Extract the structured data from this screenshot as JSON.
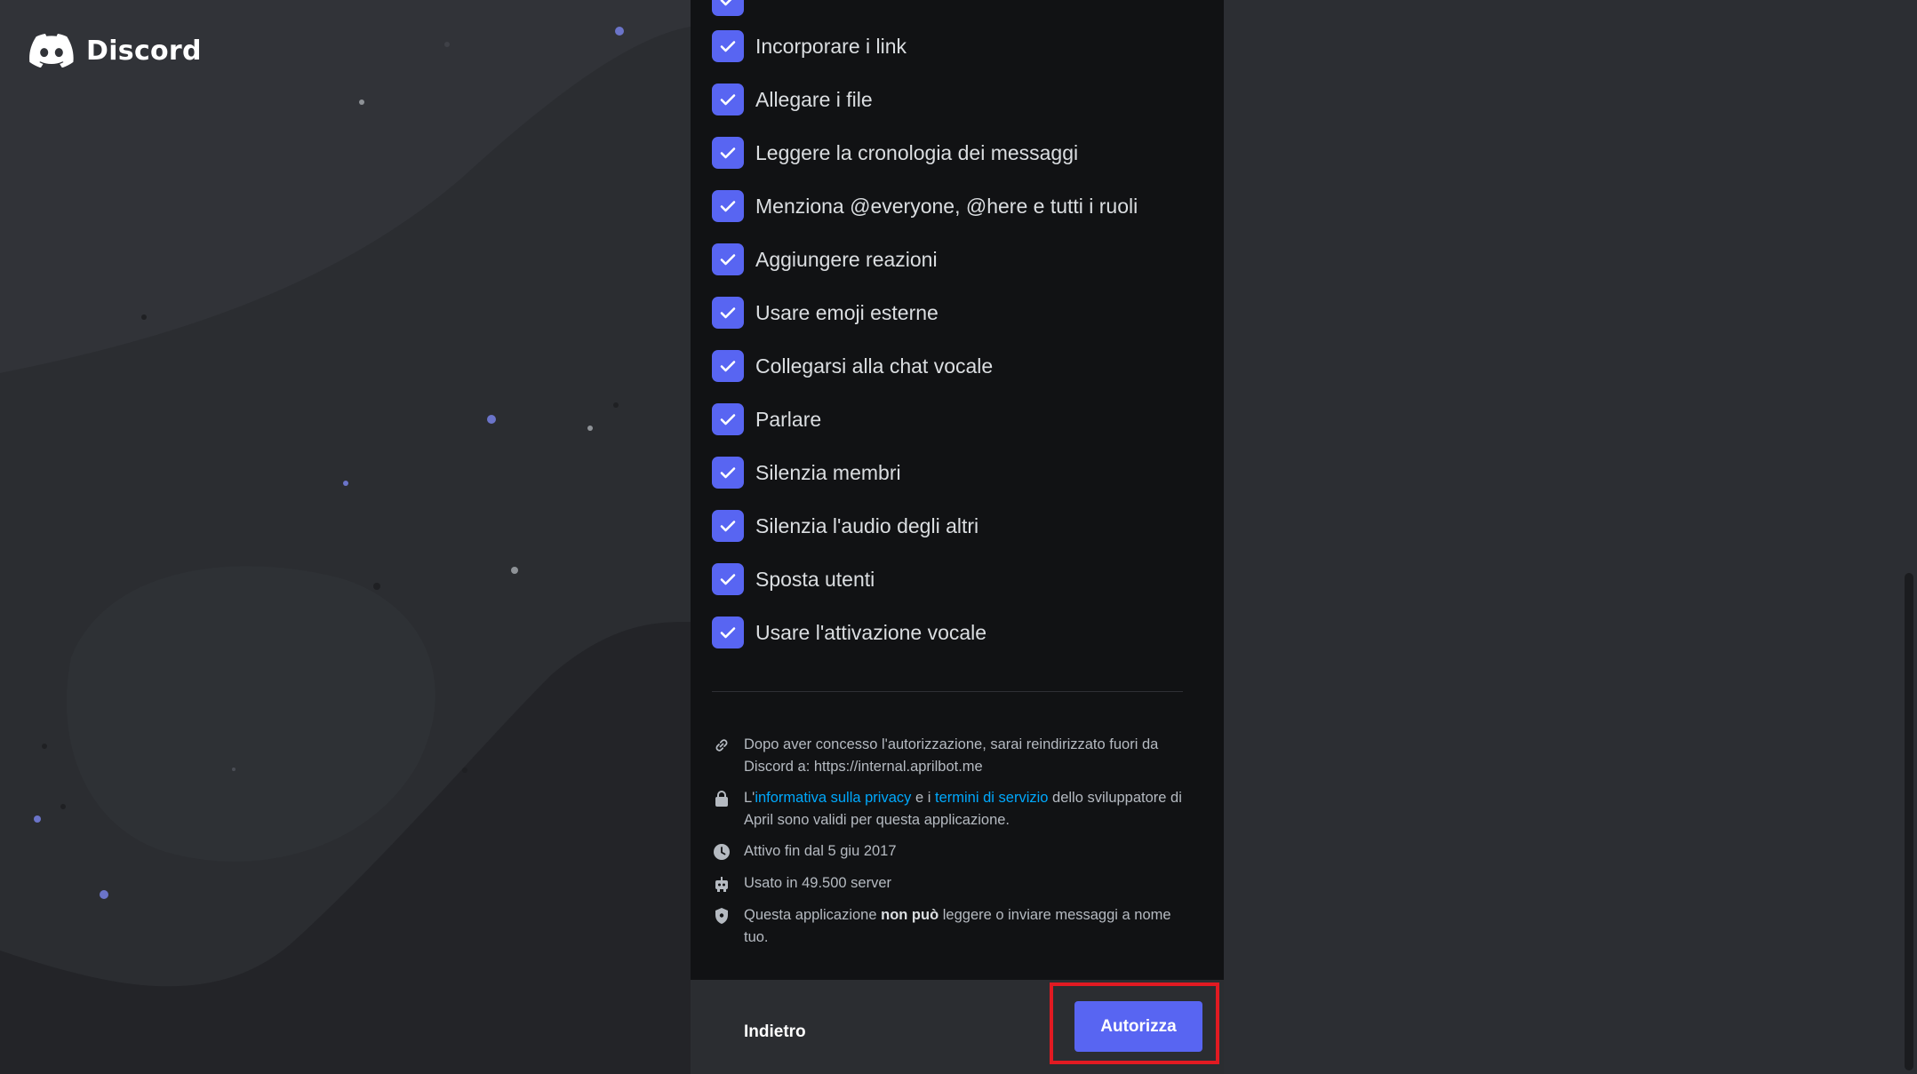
{
  "brand": {
    "name": "Discord",
    "icon": "discord-logo-icon"
  },
  "accent_color": "#5865f2",
  "permissions": [
    {
      "label": "Incorporare i link",
      "checked": true
    },
    {
      "label": "Allegare i file",
      "checked": true
    },
    {
      "label": "Leggere la cronologia dei messaggi",
      "checked": true
    },
    {
      "label": "Menziona @everyone, @here e tutti i ruoli",
      "checked": true
    },
    {
      "label": "Aggiungere reazioni",
      "checked": true
    },
    {
      "label": "Usare emoji esterne",
      "checked": true
    },
    {
      "label": "Collegarsi alla chat vocale",
      "checked": true
    },
    {
      "label": "Parlare",
      "checked": true
    },
    {
      "label": "Silenzia membri",
      "checked": true
    },
    {
      "label": "Silenzia l'audio degli altri",
      "checked": true
    },
    {
      "label": "Sposta utenti",
      "checked": true
    },
    {
      "label": "Usare l'attivazione vocale",
      "checked": true
    }
  ],
  "info": {
    "redirect": {
      "icon": "link-icon",
      "text": "Dopo aver concesso l'autorizzazione, sarai reindirizzato fuori da Discord a: https://internal.aprilbot.me"
    },
    "policy": {
      "icon": "lock-icon",
      "prefix": "L'",
      "privacy_link": "informativa sulla privacy",
      "middle": " e i ",
      "terms_link": "termini di servizio",
      "suffix": " dello sviluppatore di April sono validi per questa applicazione."
    },
    "active": {
      "icon": "clock-icon",
      "text": "Attivo fin dal 5 giu 2017"
    },
    "usage": {
      "icon": "robot-icon",
      "text": "Usato in 49.500 server"
    },
    "security": {
      "icon": "shield-icon",
      "prefix": "Questa applicazione ",
      "strong": "non può",
      "suffix": " leggere o inviare messaggi a nome tuo."
    }
  },
  "footer": {
    "back_label": "Indietro",
    "authorize_label": "Autorizza"
  }
}
